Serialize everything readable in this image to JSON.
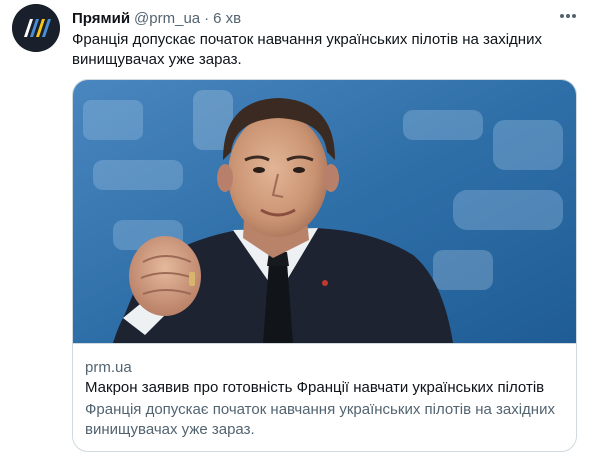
{
  "tweet": {
    "author": {
      "display_name": "Прямий",
      "handle": "@prm_ua",
      "avatar_icon": "prm-logo-icon",
      "avatar_colors": [
        "#f5c518",
        "#4a8fd9",
        "#ffffff",
        "#1a1f2c"
      ]
    },
    "separator": "·",
    "time": "6 хв",
    "text": "Франція допускає початок навчання українських пілотів на західних винищувачах уже зараз.",
    "more_icon": "more-horizontal-icon"
  },
  "card": {
    "image_alt": "Emmanuel Macron raising fist",
    "domain": "prm.ua",
    "title": "Макрон заявив про готовність Франції навчати українських пілотів",
    "description": "Франція допускає початок навчання українських пілотів на західних винищувачах уже зараз."
  },
  "colors": {
    "text_primary": "#0f1419",
    "text_secondary": "#536471",
    "border": "#cfd9de",
    "image_background": "#2f6fa8"
  }
}
